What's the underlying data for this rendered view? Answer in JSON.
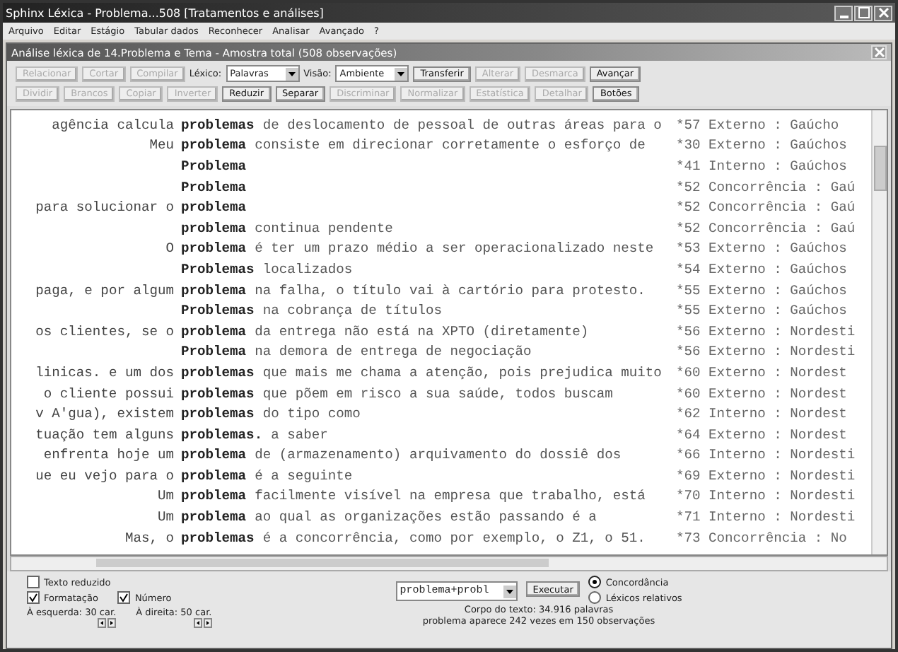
{
  "window": {
    "title": "Sphinx Léxica - Problema...508 [Tratamentos e análises]"
  },
  "menu": [
    "Arquivo",
    "Editar",
    "Estágio",
    "Tabular dados",
    "Reconhecer",
    "Analisar",
    "Avançado",
    "?"
  ],
  "inner_window": {
    "title": "Análise léxica de 14.Problema e Tema - Amostra total (508 observações)"
  },
  "toolbar_rows": [
    [
      {
        "kind": "button",
        "label": "Relacionar",
        "disabled": true
      },
      {
        "kind": "button",
        "label": "Cortar",
        "disabled": true
      },
      {
        "kind": "button",
        "label": "Compilar",
        "disabled": true
      },
      {
        "kind": "label",
        "label": "Léxico:"
      },
      {
        "kind": "select",
        "value": "Palavras"
      },
      {
        "kind": "label",
        "label": "Visão:"
      },
      {
        "kind": "select",
        "value": "Ambiente"
      },
      {
        "kind": "button",
        "label": "Transferir",
        "disabled": false
      },
      {
        "kind": "button",
        "label": "Alterar",
        "disabled": true
      },
      {
        "kind": "button",
        "label": "Desmarca",
        "disabled": true
      },
      {
        "kind": "button",
        "label": "Avançar",
        "disabled": false
      }
    ],
    [
      {
        "kind": "button",
        "label": "Dividir",
        "disabled": true
      },
      {
        "kind": "button",
        "label": "Brancos",
        "disabled": true
      },
      {
        "kind": "button",
        "label": "Copiar",
        "disabled": true
      },
      {
        "kind": "button",
        "label": "Inverter",
        "disabled": true
      },
      {
        "kind": "button",
        "label": "Reduzir",
        "disabled": false
      },
      {
        "kind": "button",
        "label": "Separar",
        "disabled": false
      },
      {
        "kind": "button",
        "label": "Discriminar",
        "disabled": true
      },
      {
        "kind": "button",
        "label": "Normalizar",
        "disabled": true
      },
      {
        "kind": "button",
        "label": "Estatística",
        "disabled": true
      },
      {
        "kind": "button",
        "label": "Detalhar",
        "disabled": true
      },
      {
        "kind": "button",
        "label": "Botões",
        "disabled": false
      }
    ]
  ],
  "concordance": [
    {
      "left": "agência calcula",
      "keyword": "problemas",
      "right": "de deslocamento de pessoal de outras áreas para o",
      "ref": "*57 Externo : Gaúcho"
    },
    {
      "left": "Meu",
      "keyword": "problema",
      "right": "consiste em direcionar corretamente o esforço de",
      "ref": "*30 Externo : Gaúchos"
    },
    {
      "keyword": "Problema",
      "ref": "*41 Interno : Gaúchos"
    },
    {
      "keyword": "Problema",
      "ref": "*52 Concorrência : Gaú"
    },
    {
      "left": "para solucionar o",
      "keyword": "problema",
      "ref": "*52 Concorrência : Gaú"
    },
    {
      "keyword": "problema",
      "right": "continua pendente",
      "ref": "*52 Concorrência : Gaú"
    },
    {
      "left": "O",
      "keyword": "problema",
      "right": "é ter um prazo médio a ser operacionalizado neste",
      "ref": "*53 Externo : Gaúchos"
    },
    {
      "keyword": "Problemas",
      "right": "localizados",
      "ref": "*54 Externo : Gaúchos"
    },
    {
      "left": "paga, e por algum",
      "keyword": "problema",
      "right": "na falha, o título vai à cartório para protesto.",
      "ref": "*55 Externo : Gaúchos"
    },
    {
      "keyword": "Problemas",
      "right": "na cobrança de títulos",
      "ref": "*55 Externo : Gaúchos"
    },
    {
      "left": "os clientes, se o",
      "keyword": "problema",
      "right": "da entrega não está na XPTO (diretamente)",
      "ref": "*56 Externo : Nordesti"
    },
    {
      "keyword": "Problema",
      "right": "na demora de entrega de negociação",
      "ref": "*56 Externo : Nordesti"
    },
    {
      "left": "linicas. e um dos",
      "keyword": "problemas",
      "right": "que mais me chama a atenção, pois prejudica muito",
      "ref": "*60 Externo : Nordest"
    },
    {
      "left": "o cliente possui",
      "keyword": "problemas",
      "right": "que põem em risco a sua saúde, todos buscam",
      "ref": "*60 Externo : Nordest"
    },
    {
      "left": "v A'gua), existem",
      "keyword": "problemas",
      "right": "do tipo como",
      "ref": "*62 Interno : Nordest"
    },
    {
      "left": "tuação tem alguns",
      "keyword": "problemas.",
      "right": "a saber",
      "ref": "*64 Externo : Nordest"
    },
    {
      "left": "enfrenta hoje um",
      "keyword": "problema",
      "right": "de (armazenamento) arquivamento do dossiê dos",
      "ref": "*66 Interno : Nordesti"
    },
    {
      "left": "ue eu vejo para o",
      "keyword": "problema",
      "right": "é a seguinte",
      "ref": "*69 Externo : Nordesti"
    },
    {
      "left": "Um",
      "keyword": "problema",
      "right": "facilmente visível na empresa que trabalho, está",
      "ref": "*70 Interno : Nordesti"
    },
    {
      "left": "Um",
      "keyword": "problema",
      "right": "ao qual as organizações estão passando é a",
      "ref": "*71 Interno : Nordesti"
    },
    {
      "left": "Mas, o",
      "keyword": "problemas",
      "right": "é a concorrência, como por exemplo, o Z1, o 51.",
      "ref": "*73 Concorrência : No"
    }
  ],
  "options": {
    "checkboxes": [
      {
        "label": "Texto reduzido",
        "checked": false
      },
      {
        "label": "Formatação",
        "checked": true
      },
      {
        "label": "Número",
        "checked": true
      }
    ],
    "spinners": [
      "À esquerda: 30 car.",
      "À direita: 50 car."
    ],
    "query": "problema+probl",
    "execute": "Executar",
    "radios": [
      {
        "label": "Concordância",
        "selected": true
      },
      {
        "label": "Léxicos relativos",
        "selected": false
      }
    ],
    "status": [
      "Corpo do texto: 34.916 palavras",
      "problema aparece 242 vezes em 150 observações"
    ]
  }
}
